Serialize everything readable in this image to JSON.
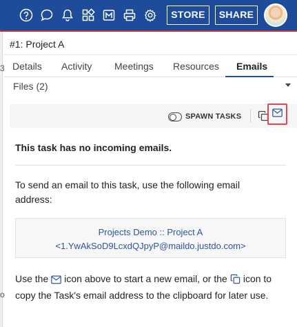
{
  "topbar": {
    "icons": [
      "help-icon",
      "chat-icon",
      "bell-icon",
      "apps-icon",
      "mail-m-icon",
      "print-icon",
      "gear-icon"
    ],
    "store_label": "STORE",
    "share_label": "SHARE",
    "bg_color": "#1e4b9a"
  },
  "gutter": {
    "letter1": "3",
    "letter2": "o"
  },
  "task": {
    "title": "#1: Project A"
  },
  "tabs": [
    {
      "label": "Details"
    },
    {
      "label": "Activity"
    },
    {
      "label": "Meetings"
    },
    {
      "label": "Resources"
    },
    {
      "label": "Emails",
      "active": true
    }
  ],
  "files_tab": {
    "label": "Files (2)"
  },
  "email_toolbar": {
    "spawn_label": "SPAWN TASKS"
  },
  "content": {
    "no_emails": "This task has no incoming emails.",
    "instructions": "To send an email to this task, use the following email address:",
    "address_name": "Projects Demo :: Project A",
    "address_email": "<1.YwAkSoD9LcxdQJpyP@maildo.justdo.com>",
    "help_part1": "Use the",
    "help_part2": "icon above to start a new email, or the",
    "help_part3": "icon to copy the Task's email address to the clipboard for later use."
  },
  "colors": {
    "accent": "#1e4b9a",
    "highlight": "#e0464a",
    "link": "#2f5596"
  }
}
